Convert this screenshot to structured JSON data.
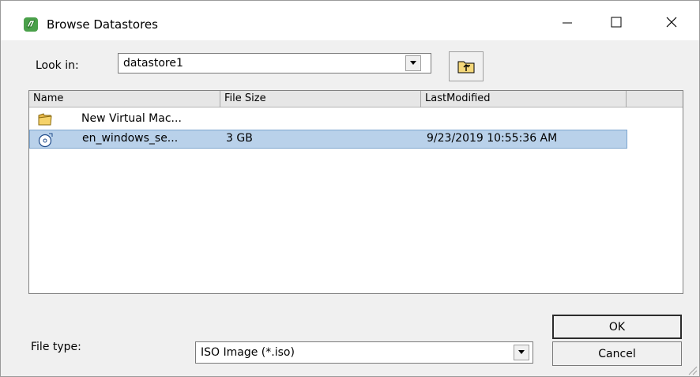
{
  "window": {
    "title": "Browse Datastores",
    "icon": "vsphere-datastore-icon"
  },
  "lookin": {
    "label": "Look in:",
    "value": "datastore1"
  },
  "filelist": {
    "columns": [
      "Name",
      "File Size",
      "LastModified"
    ],
    "rows": [
      {
        "icon": "folder-icon",
        "name": "New Virtual Mac...",
        "size": "",
        "modified": ""
      },
      {
        "icon": "disc-image-icon",
        "name": "en_windows_se...",
        "size": "3 GB",
        "modified": "9/23/2019 10:55:36 AM",
        "selected": true
      }
    ]
  },
  "filetype": {
    "label": "File type:",
    "value": "ISO Image (*.iso)"
  },
  "buttons": {
    "ok": "OK",
    "cancel": "Cancel"
  },
  "colors": {
    "selection": "#b9d1ea",
    "selection_border": "#7ea6cf",
    "folder": "#e8b84a",
    "icon_green": "#4aa04a"
  }
}
